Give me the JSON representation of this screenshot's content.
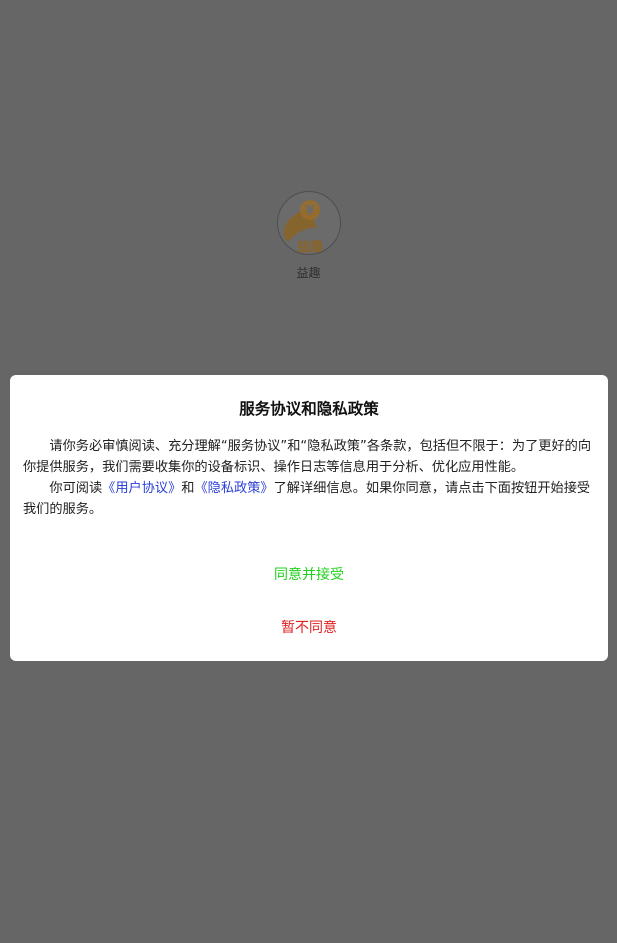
{
  "app": {
    "name": "益趣",
    "logo_text": "益趣",
    "logo_symbol": "¥"
  },
  "dialog": {
    "title": "服务协议和隐私政策",
    "paragraph1": "请你务必审慎阅读、充分理解“服务协议”和“隐私政策”各条款，包括但不限于：为了更好的向你提供服务，我们需要收集你的设备标识、操作日志等信息用于分析、优化应用性能。",
    "paragraph2_prefix": "你可阅读",
    "user_agreement_link": "《用户协议》",
    "paragraph2_and": "和",
    "privacy_policy_link": "《隐私政策》",
    "paragraph2_suffix": "了解详细信息。如果你同意，请点击下面按钮开始接受我们的服务。",
    "accept_label": "同意并接受",
    "decline_label": "暂不同意"
  },
  "colors": {
    "overlay": "#666666",
    "accept": "#22d11f",
    "decline": "#e02020",
    "link": "#2c3fd8",
    "logo_gold": "#9a6d2a"
  }
}
